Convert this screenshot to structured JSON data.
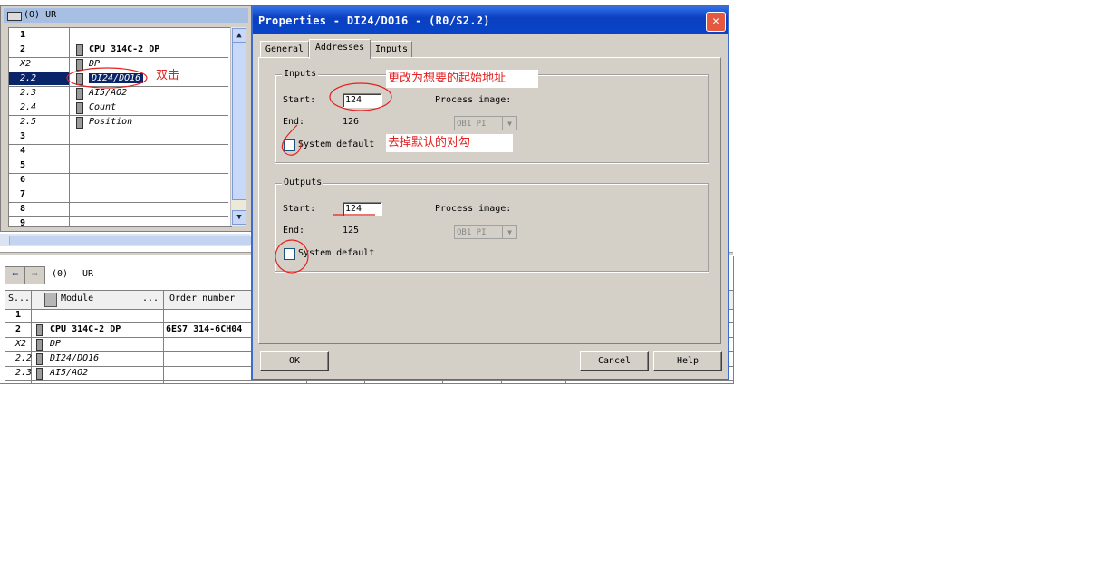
{
  "rack": {
    "title": "(O) UR",
    "rows": [
      {
        "slot": "1",
        "module": ""
      },
      {
        "slot": "2",
        "module": "CPU 314C-2 DP"
      },
      {
        "slot": "X2",
        "module": "DP"
      },
      {
        "slot": "2.2",
        "module": "DI24/DO16"
      },
      {
        "slot": "2.3",
        "module": "AI5/AO2"
      },
      {
        "slot": "2.4",
        "module": "Count"
      },
      {
        "slot": "2.5",
        "module": "Position"
      },
      {
        "slot": "3",
        "module": ""
      },
      {
        "slot": "4",
        "module": ""
      },
      {
        "slot": "5",
        "module": ""
      },
      {
        "slot": "6",
        "module": ""
      },
      {
        "slot": "7",
        "module": ""
      },
      {
        "slot": "8",
        "module": ""
      },
      {
        "slot": "9",
        "module": ""
      }
    ],
    "selected_slot": "2.2",
    "annotation": "双击"
  },
  "bottom": {
    "station_slot": "(0)",
    "station_name": "UR",
    "columns": [
      "S...",
      "Module",
      "...",
      "Order number"
    ],
    "rows": [
      {
        "slot": "1",
        "module": "",
        "order": ""
      },
      {
        "slot": "2",
        "module": "CPU 314C-2 DP",
        "order": "6ES7 314-6CH04"
      },
      {
        "slot": "X2",
        "module": "DP",
        "order": ""
      },
      {
        "slot": "2.2",
        "module": "DI24/DO16",
        "order": ""
      },
      {
        "slot": "2.3",
        "module": "AI5/AO2",
        "order": ""
      }
    ]
  },
  "dialog": {
    "title": "Properties - DI24/DO16 - (R0/S2.2)",
    "close_icon": "close-icon",
    "tabs": [
      {
        "label": "General",
        "active": false
      },
      {
        "label": "Addresses",
        "active": true
      },
      {
        "label": "Inputs",
        "active": false
      }
    ],
    "inputs": {
      "group_label": "Inputs",
      "start_label": "Start:",
      "start_value": "124",
      "end_label": "End:",
      "end_value": "126",
      "process_image_label": "Process image:",
      "process_image_value": "OB1 PI",
      "system_default_label": "System default",
      "system_default_checked": false
    },
    "outputs": {
      "group_label": "Outputs",
      "start_label": "Start:",
      "start_value": "124",
      "end_label": "End:",
      "end_value": "125",
      "process_image_label": "Process image:",
      "process_image_value": "OB1 PI",
      "system_default_label": "System default",
      "system_default_checked": false
    },
    "buttons": {
      "ok": "OK",
      "cancel": "Cancel",
      "help": "Help"
    },
    "annotation_start": "更改为想要的起始地址",
    "annotation_default": "去掉默认的对勾"
  },
  "colors": {
    "annotation": "#e32121",
    "title_bar": "#0a46c8",
    "selection": "#0a246a"
  }
}
